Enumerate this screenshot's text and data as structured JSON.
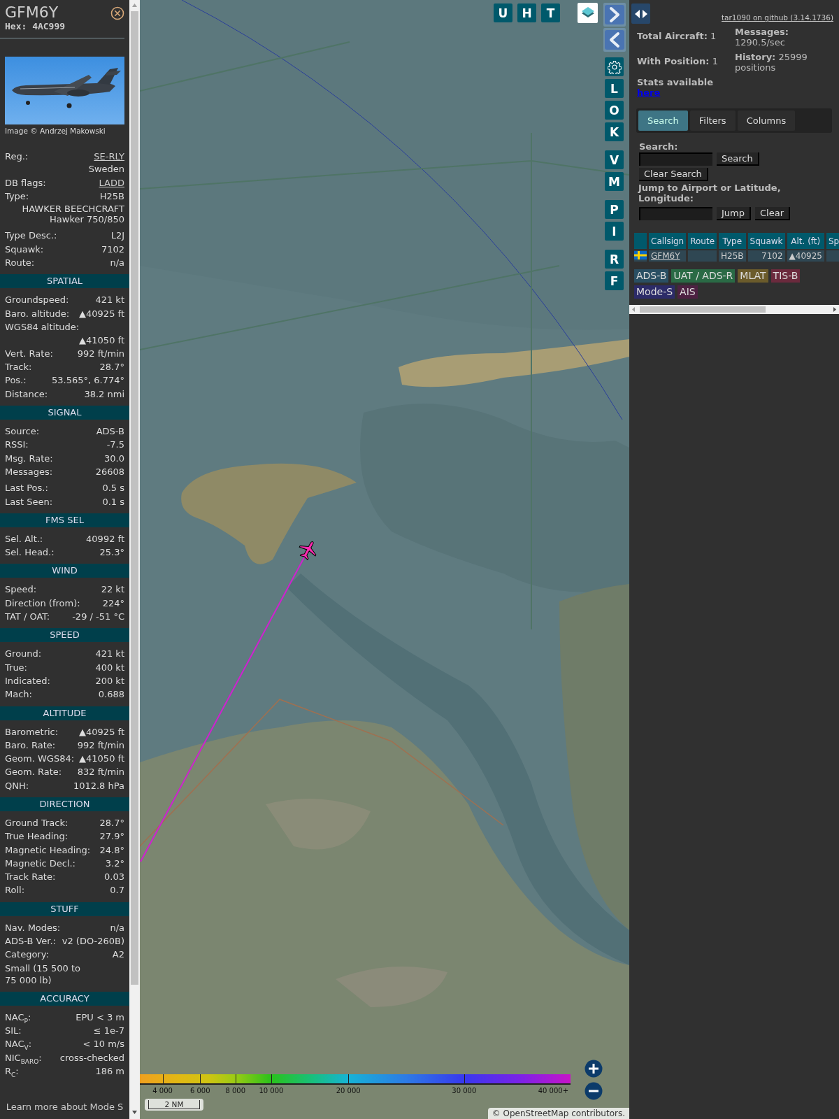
{
  "aircraft_panel": {
    "callsign": "GFM6Y",
    "hex": "Hex: 4AC999",
    "photo": {
      "kind": "picture",
      "credit": "Image © Andrzej Makowski"
    },
    "details": [
      [
        {
          "kind": "link",
          "label": "Reg.:",
          "value": "SE-RLY"
        },
        {
          "kind": "note",
          "value": "Sweden"
        },
        {
          "kind": "link",
          "label": "DB flags:",
          "value": "LADD"
        },
        {
          "kind": "pair",
          "label": "Type:",
          "value": "H25B"
        },
        {
          "kind": "note",
          "value": "HAWKER BEECHCRAFT\nHawker 750/850"
        }
      ],
      [
        {
          "kind": "pair",
          "label": "Type Desc.:",
          "value": "L2J"
        },
        {
          "kind": "pair",
          "label": "Squawk:",
          "value": "7102"
        },
        {
          "kind": "pair",
          "label": "Route:",
          "value": "n/a"
        }
      ]
    ],
    "sections": [
      {
        "title": "SPATIAL",
        "groups": [
          [
            {
              "kind": "pair",
              "label": "Groundspeed:",
              "value": "421 kt"
            },
            {
              "kind": "pair",
              "label": "Baro. altitude:",
              "value": "▲40925 ft"
            },
            {
              "kind": "stacked",
              "label": "WGS84 altitude:",
              "value": "▲41050 ft"
            },
            {
              "kind": "pair",
              "label": "Vert. Rate:",
              "value": "992 ft/min"
            },
            {
              "kind": "pair",
              "label": "Track:",
              "value": "28.7°"
            },
            {
              "kind": "pair",
              "label": "Pos.:",
              "value": "53.565°, 6.774°"
            },
            {
              "kind": "pair",
              "label": "Distance:",
              "value": "38.2 nmi"
            }
          ]
        ]
      },
      {
        "title": "SIGNAL",
        "groups": [
          [
            {
              "kind": "pair",
              "label": "Source:",
              "value": "ADS-B"
            },
            {
              "kind": "pair",
              "label": "RSSI:",
              "value": "-7.5"
            },
            {
              "kind": "pair",
              "label": "Msg. Rate:",
              "value": "30.0"
            },
            {
              "kind": "pair",
              "label": "Messages:",
              "value": "26608"
            }
          ],
          [
            {
              "kind": "pair",
              "label": "Last Pos.:",
              "value": "0.5 s"
            },
            {
              "kind": "pair",
              "label": "Last Seen:",
              "value": "0.1 s"
            }
          ]
        ]
      },
      {
        "title": "FMS SEL",
        "groups": [
          [
            {
              "kind": "pair",
              "label": "Sel. Alt.:",
              "value": "40992 ft"
            },
            {
              "kind": "pair",
              "label": "Sel. Head.:",
              "value": "25.3°"
            }
          ]
        ]
      },
      {
        "title": "WIND",
        "groups": [
          [
            {
              "kind": "pair",
              "label": "Speed:",
              "value": "22 kt"
            },
            {
              "kind": "pair",
              "label": "Direction (from):",
              "value": "224°"
            },
            {
              "kind": "pair",
              "label": "TAT / OAT:",
              "value": "-29 / -51 °C"
            }
          ]
        ]
      },
      {
        "title": "SPEED",
        "groups": [
          [
            {
              "kind": "pair",
              "label": "Ground:",
              "value": "421 kt"
            },
            {
              "kind": "pair",
              "label": "True:",
              "value": "400 kt"
            },
            {
              "kind": "pair",
              "label": "Indicated:",
              "value": "200 kt"
            },
            {
              "kind": "pair",
              "label": "Mach:",
              "value": "0.688"
            }
          ]
        ]
      },
      {
        "title": "ALTITUDE",
        "groups": [
          [
            {
              "kind": "pair",
              "label": "Barometric:",
              "value": "▲40925 ft"
            },
            {
              "kind": "pair",
              "label": "Baro. Rate:",
              "value": "992 ft/min"
            },
            {
              "kind": "pair",
              "label": "Geom. WGS84:",
              "value": "▲41050 ft"
            },
            {
              "kind": "pair",
              "label": "Geom. Rate:",
              "value": "832 ft/min"
            },
            {
              "kind": "pair",
              "label": "QNH:",
              "value": "1012.8 hPa"
            }
          ]
        ]
      },
      {
        "title": "DIRECTION",
        "groups": [
          [
            {
              "kind": "pair",
              "label": "Ground Track:",
              "value": "28.7°"
            },
            {
              "kind": "pair",
              "label": "True Heading:",
              "value": "27.9°"
            },
            {
              "kind": "pair",
              "label": "Magnetic Heading:",
              "value": "24.8°"
            },
            {
              "kind": "pair",
              "label": "Magnetic Decl.:",
              "value": "3.2°"
            },
            {
              "kind": "pair",
              "label": "Track Rate:",
              "value": "0.03"
            },
            {
              "kind": "pair",
              "label": "Roll:",
              "value": "0.7"
            }
          ]
        ]
      },
      {
        "title": "STUFF",
        "groups": [
          [
            {
              "kind": "pair",
              "label": "Nav. Modes:",
              "value": "n/a"
            },
            {
              "kind": "pair",
              "label": "ADS-B Ver.:",
              "value": "v2 (DO-260B)"
            },
            {
              "kind": "pair",
              "label": "Category:",
              "value": "A2"
            },
            {
              "kind": "text",
              "value": "Small (15 500 to 75 000 lb)"
            }
          ]
        ]
      },
      {
        "title": "ACCURACY",
        "groups": [
          [
            {
              "kind": "pair",
              "label": "NAC$_{P}$:",
              "value": "EPU < 3 m"
            },
            {
              "kind": "pair",
              "label": "SIL:",
              "value": "≤ 1e-7"
            },
            {
              "kind": "pair",
              "label": "NAC$_{V}$:",
              "value": "< 10 m/s"
            },
            {
              "kind": "pair",
              "label": "NIC$_{BARO}$:",
              "value": "cross-checked"
            },
            {
              "kind": "pair",
              "label": "R$_{C}$:",
              "value": "186 m"
            }
          ]
        ]
      }
    ],
    "footer": "Learn more about Mode S"
  },
  "map": {
    "toolbar": [
      "U",
      "H",
      "T"
    ],
    "side_buttons": [
      [
        {
          "kind": "next"
        },
        {
          "kind": "prev"
        }
      ],
      [
        {
          "kind": "settings"
        },
        {
          "kind": "letter",
          "label": "L"
        },
        {
          "kind": "letter",
          "label": "O"
        },
        {
          "kind": "letter",
          "label": "K"
        }
      ],
      [
        {
          "kind": "letter",
          "label": "V"
        },
        {
          "kind": "letter",
          "label": "M"
        }
      ],
      [
        {
          "kind": "letter",
          "label": "P"
        },
        {
          "kind": "letter",
          "label": "I"
        }
      ],
      [
        {
          "kind": "letter",
          "label": "R"
        },
        {
          "kind": "letter",
          "label": "F"
        }
      ]
    ],
    "altitude_legend": [
      "4 000",
      "6 000",
      "8 000",
      "10 000",
      "20 000",
      "30 000",
      "40 000+"
    ],
    "scale": "2 NM",
    "attribution": "© OpenStreetMap contributors."
  },
  "list_panel": {
    "version_link": "tar1090 on github (3.14.1736)",
    "stats": [
      {
        "label": "Total Aircraft:",
        "value": "1"
      },
      {
        "label": "Messages:",
        "value": "1290.5/sec"
      },
      {
        "label": "With Position:",
        "value": "1"
      },
      {
        "label": "History:",
        "value": "25999 positions"
      }
    ],
    "stats_note": {
      "text": "Stats available",
      "link": "here"
    },
    "tabs": [
      {
        "label": "Search",
        "selected": true
      },
      {
        "label": "Filters",
        "selected": false
      },
      {
        "label": "Columns",
        "selected": false
      }
    ],
    "search": {
      "label": "Search:",
      "button": "Search",
      "clear_button": "Clear Search"
    },
    "jump": {
      "label": "Jump to Airport or Latitude, Longitude:",
      "buttons": [
        "Jump",
        "Clear"
      ]
    },
    "table": {
      "columns": [
        "Callsign",
        "Route",
        "Type",
        "Squawk",
        "Alt. (ft)",
        "Sp"
      ],
      "rows": [
        {
          "callsign": "GFM6Y",
          "type": "H25B",
          "squawk": "7102",
          "altitude": "▲40925"
        }
      ]
    },
    "legend": [
      {
        "label": "ADS-B",
        "color": "#2a4f63"
      },
      {
        "label": "UAT / ADS-R",
        "color": "#2a6a45"
      },
      {
        "label": "MLAT",
        "color": "#6b5b2b"
      },
      {
        "label": "TIS-B",
        "color": "#6b2a3d"
      },
      {
        "label": "Mode-S",
        "color": "#2c2b68"
      },
      {
        "label": "AIS",
        "color": "#4d2142"
      }
    ]
  }
}
